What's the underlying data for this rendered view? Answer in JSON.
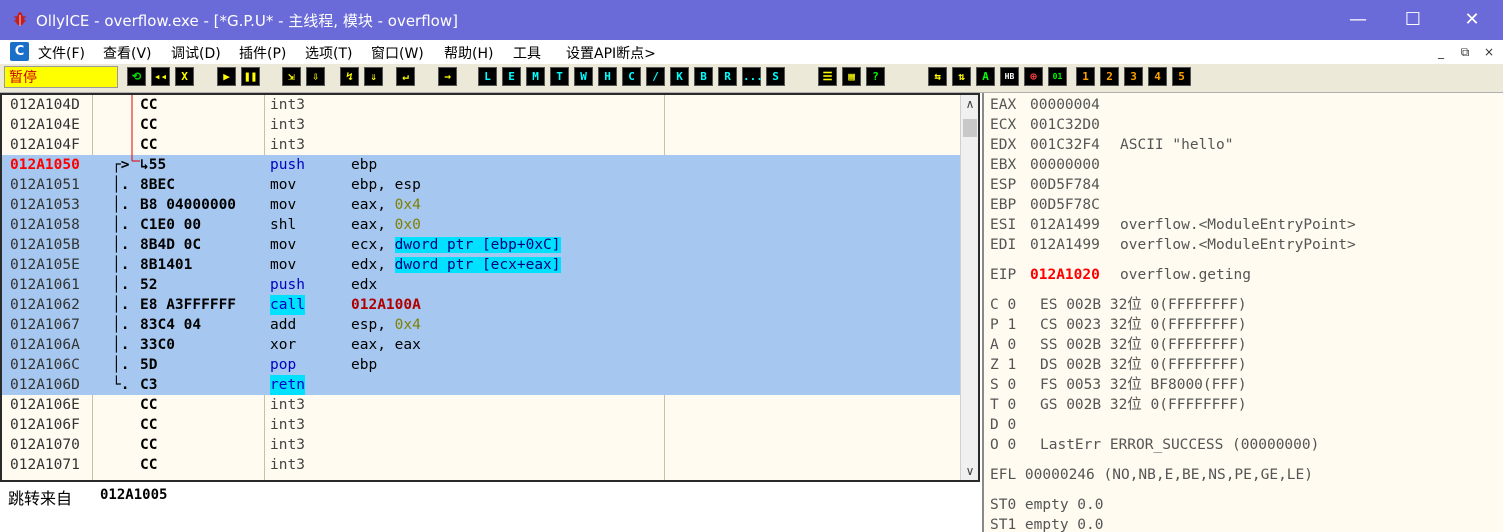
{
  "window": {
    "title": "OllyICE - overflow.exe - [*G.P.U* -  主线程, 模块 - overflow]",
    "controls": {
      "minimize": "—",
      "maximize": "☐",
      "close": "✕"
    }
  },
  "menu": {
    "items": [
      "文件(F)",
      "查看(V)",
      "调试(D)",
      "插件(P)",
      "选项(T)",
      "窗口(W)",
      "帮助(H)",
      "工具",
      "设置API断点>"
    ],
    "mdi_icon": "C",
    "mdi_controls": [
      "_",
      "⧉",
      "×"
    ]
  },
  "toolbar": {
    "status": "暂停",
    "buttons": [
      "⟲",
      "◂◂",
      "X",
      "▶",
      "❚❚",
      "⇲",
      "⇩",
      "↯",
      "⇓",
      "↵",
      "→",
      "L",
      "E",
      "M",
      "T",
      "W",
      "H",
      "C",
      "/",
      "K",
      "B",
      "R",
      "...",
      "S",
      "☰",
      "▦",
      "?",
      "⇆",
      "⇅",
      "A",
      "HB",
      "⊕",
      "01",
      "1",
      "2",
      "3",
      "4",
      "5"
    ]
  },
  "disasm": {
    "rows": [
      {
        "addr": "012A104D",
        "mark": "",
        "hex": "CC",
        "mn": "int3",
        "op": ""
      },
      {
        "addr": "012A104E",
        "mark": "",
        "hex": "CC",
        "mn": "int3",
        "op": ""
      },
      {
        "addr": "012A104F",
        "mark": "",
        "hex": "CC",
        "mn": "int3",
        "op": ""
      },
      {
        "addr": "012A1050",
        "mark": "┌>",
        "hex": "↳55",
        "mn": "push",
        "op": "ebp"
      },
      {
        "addr": "012A1051",
        "mark": "│.",
        "hex": "8BEC",
        "mn": "mov",
        "op": "ebp, esp"
      },
      {
        "addr": "012A1053",
        "mark": "│.",
        "hex": "B8 04000000",
        "mn": "mov",
        "op": "eax, ",
        "imm": "0x4"
      },
      {
        "addr": "012A1058",
        "mark": "│.",
        "hex": "C1E0 00",
        "mn": "shl",
        "op": "eax, ",
        "imm": "0x0"
      },
      {
        "addr": "012A105B",
        "mark": "│.",
        "hex": "8B4D 0C",
        "mn": "mov",
        "op": "ecx, ",
        "mem": "dword ptr [ebp+0xC]"
      },
      {
        "addr": "012A105E",
        "mark": "│.",
        "hex": "8B1401",
        "mn": "mov",
        "op": "edx, ",
        "mem": "dword ptr [ecx+eax]"
      },
      {
        "addr": "012A1061",
        "mark": "│.",
        "hex": "52",
        "mn": "push",
        "op": "edx"
      },
      {
        "addr": "012A1062",
        "mark": "│.",
        "hex": "E8 A3FFFFFF",
        "mn": "call",
        "op": "",
        "target": "012A100A"
      },
      {
        "addr": "012A1067",
        "mark": "│.",
        "hex": "83C4 04",
        "mn": "add",
        "op": "esp, ",
        "imm": "0x4"
      },
      {
        "addr": "012A106A",
        "mark": "│.",
        "hex": "33C0",
        "mn": "xor",
        "op": "eax, eax"
      },
      {
        "addr": "012A106C",
        "mark": "│.",
        "hex": "5D",
        "mn": "pop",
        "op": "ebp"
      },
      {
        "addr": "012A106D",
        "mark": "└.",
        "hex": "C3",
        "mn": "retn",
        "op": ""
      },
      {
        "addr": "012A106E",
        "mark": "",
        "hex": "CC",
        "mn": "int3",
        "op": ""
      },
      {
        "addr": "012A106F",
        "mark": "",
        "hex": "CC",
        "mn": "int3",
        "op": ""
      },
      {
        "addr": "012A1070",
        "mark": "",
        "hex": "CC",
        "mn": "int3",
        "op": ""
      },
      {
        "addr": "012A1071",
        "mark": "",
        "hex": "CC",
        "mn": "int3",
        "op": ""
      }
    ],
    "current_address": "012A1050"
  },
  "info": {
    "label": "跳转来自",
    "value": "012A1005"
  },
  "registers": {
    "gp": [
      {
        "name": "EAX",
        "value": "00000004",
        "comment": ""
      },
      {
        "name": "ECX",
        "value": "001C32D0",
        "comment": ""
      },
      {
        "name": "EDX",
        "value": "001C32F4",
        "comment": "ASCII \"hello\""
      },
      {
        "name": "EBX",
        "value": "00000000",
        "comment": ""
      },
      {
        "name": "ESP",
        "value": "00D5F784",
        "comment": ""
      },
      {
        "name": "EBP",
        "value": "00D5F78C",
        "comment": ""
      },
      {
        "name": "ESI",
        "value": "012A1499",
        "comment": "overflow.<ModuleEntryPoint>"
      },
      {
        "name": "EDI",
        "value": "012A1499",
        "comment": "overflow.<ModuleEntryPoint>"
      }
    ],
    "eip": {
      "name": "EIP",
      "value": "012A1020",
      "comment": "overflow.geting"
    },
    "flags": [
      {
        "flag": "C 0",
        "seg": "ES 002B 32位 0(FFFFFFFF)"
      },
      {
        "flag": "P 1",
        "seg": "CS 0023 32位 0(FFFFFFFF)"
      },
      {
        "flag": "A 0",
        "seg": "SS 002B 32位 0(FFFFFFFF)"
      },
      {
        "flag": "Z 1",
        "seg": "DS 002B 32位 0(FFFFFFFF)"
      },
      {
        "flag": "S 0",
        "seg": "FS 0053 32位 BF8000(FFF)"
      },
      {
        "flag": "T 0",
        "seg": "GS 002B 32位 0(FFFFFFFF)"
      },
      {
        "flag": "D 0",
        "seg": ""
      },
      {
        "flag": "O 0",
        "seg": "LastErr ERROR_SUCCESS (00000000)"
      }
    ],
    "efl": "EFL 00000246 (NO,NB,E,BE,NS,PE,GE,LE)",
    "fpu": [
      "ST0 empty 0.0",
      "ST1 empty 0.0"
    ]
  }
}
